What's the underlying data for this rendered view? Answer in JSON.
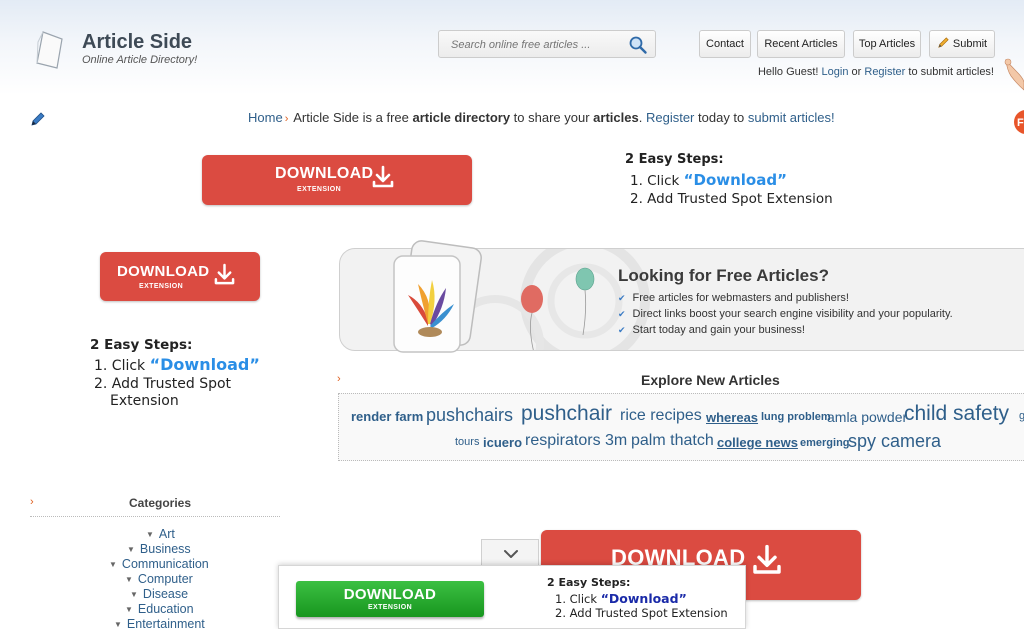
{
  "brand": {
    "title": "Article Side",
    "tagline": "Online Article Directory!"
  },
  "search": {
    "placeholder": "Search online free articles ..."
  },
  "nav": {
    "contact": "Contact",
    "recent": "Recent Articles",
    "top": "Top Articles",
    "submit": "Submit"
  },
  "greeting": {
    "prefix": "Hello Guest!",
    "login": "Login",
    "or": "or",
    "register": "Register",
    "suffix": "to submit articles!"
  },
  "breadcrumb": {
    "home": "Home",
    "sep": "›",
    "t1": "Article Side is a free",
    "b1": "article directory",
    "t2": "to share your",
    "b2": "articles",
    "t3": ".",
    "register": "Register",
    "t4": "today to",
    "submit": "submit articles!"
  },
  "ad": {
    "download": "DOWNLOAD",
    "extension": "EXTENSION",
    "steps_title": "2 Easy Steps:",
    "step1_prefix": "1. Click",
    "step1_link": "“Download”",
    "step2": "2. Add Trusted Spot Extension",
    "step2_a": "2. Add Trusted Spot",
    "step2_b": "Extension",
    "colors": {
      "red": "#db4b41",
      "green": "#1fa526",
      "link_blue": "#2a8ee6"
    }
  },
  "banner": {
    "title": "Looking for Free Articles?",
    "items": [
      "Free articles for webmasters and publishers!",
      "Direct links boost your search engine visibility and your popularity.",
      "Start today and gain your business!"
    ]
  },
  "explore": {
    "title": "Explore New Articles",
    "tags": [
      "render farm",
      "pushchairs",
      "pushchair",
      "rice recipes",
      "whereas",
      "lung problem",
      "amla powder",
      "child safety",
      "g",
      "tours",
      "icuero",
      "respirators",
      "3m",
      "palm thatch",
      "college news",
      "emerging",
      "spy camera"
    ]
  },
  "categories": {
    "title": "Categories",
    "items": [
      "Art",
      "Business",
      "Communication",
      "Computer",
      "Disease",
      "Education",
      "Entertainment"
    ]
  }
}
